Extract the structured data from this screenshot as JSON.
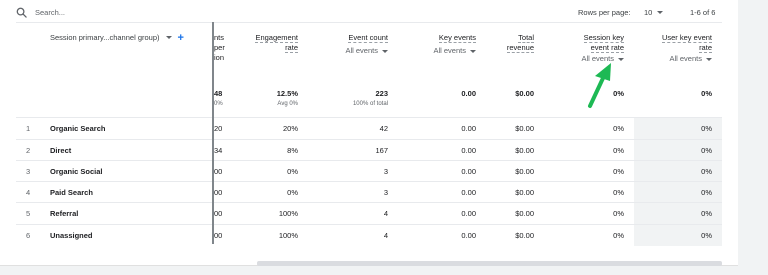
{
  "search": {
    "placeholder": "Search..."
  },
  "pagination": {
    "rows_per_page_label": "Rows per page:",
    "rows_per_page_value": "10",
    "range": "1-6 of 6"
  },
  "table": {
    "dimension_header": "Session primary...channel group)",
    "partial_header": [
      "nts",
      "per",
      "ion"
    ],
    "columns": [
      {
        "title_lines": [
          "Engagement",
          "rate"
        ],
        "sub": ""
      },
      {
        "title_lines": [
          "Event count"
        ],
        "sub": "All events"
      },
      {
        "title_lines": [
          "Key events"
        ],
        "sub": "All events"
      },
      {
        "title_lines": [
          "Total",
          "revenue"
        ],
        "sub": ""
      },
      {
        "title_lines": [
          "Session key",
          "event rate"
        ],
        "sub": "All events"
      },
      {
        "title_lines": [
          "User key event",
          "rate"
        ],
        "sub": "All events"
      }
    ],
    "totals": {
      "partial": "48",
      "partial_pct": "0%",
      "engagement_rate": "12.5%",
      "engagement_rate_sub": "Avg 0%",
      "event_count": "223",
      "event_count_sub": "100% of total",
      "key_events": "0.00",
      "total_revenue": "$0.00",
      "session_key_event_rate": "0%",
      "user_key_event_rate": "0%"
    },
    "rows": [
      {
        "idx": "1",
        "name": "Organic Search",
        "partial": "20",
        "engagement_rate": "20%",
        "event_count": "42",
        "key_events": "0.00",
        "total_revenue": "$0.00",
        "session_rate": "0%",
        "user_rate": "0%"
      },
      {
        "idx": "2",
        "name": "Direct",
        "partial": "34",
        "engagement_rate": "8%",
        "event_count": "167",
        "key_events": "0.00",
        "total_revenue": "$0.00",
        "session_rate": "0%",
        "user_rate": "0%"
      },
      {
        "idx": "3",
        "name": "Organic Social",
        "partial": "00",
        "engagement_rate": "0%",
        "event_count": "3",
        "key_events": "0.00",
        "total_revenue": "$0.00",
        "session_rate": "0%",
        "user_rate": "0%"
      },
      {
        "idx": "4",
        "name": "Paid Search",
        "partial": "00",
        "engagement_rate": "0%",
        "event_count": "3",
        "key_events": "0.00",
        "total_revenue": "$0.00",
        "session_rate": "0%",
        "user_rate": "0%"
      },
      {
        "idx": "5",
        "name": "Referral",
        "partial": "00",
        "engagement_rate": "100%",
        "event_count": "4",
        "key_events": "0.00",
        "total_revenue": "$0.00",
        "session_rate": "0%",
        "user_rate": "0%"
      },
      {
        "idx": "6",
        "name": "Unassigned",
        "partial": "00",
        "engagement_rate": "100%",
        "event_count": "4",
        "key_events": "0.00",
        "total_revenue": "$0.00",
        "session_rate": "0%",
        "user_rate": "0%"
      }
    ]
  },
  "colors": {
    "accent": "#1a73e8",
    "arrow": "#1db954",
    "shaded_column": "#f1f3f4"
  }
}
